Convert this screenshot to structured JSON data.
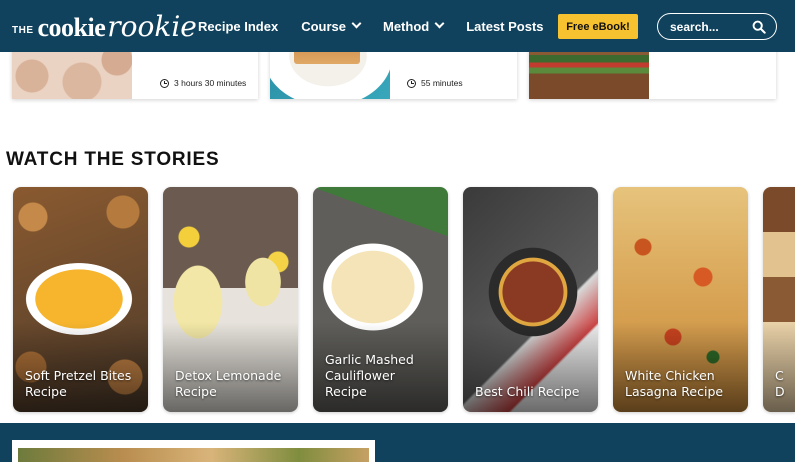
{
  "header": {
    "logo": {
      "the": "THE",
      "word1": "cookie",
      "word2": "rookie"
    },
    "nav": [
      {
        "label": "Recipe Index",
        "dropdown": false
      },
      {
        "label": "Course",
        "dropdown": true
      },
      {
        "label": "Method",
        "dropdown": true
      },
      {
        "label": "Latest Posts",
        "dropdown": false
      }
    ],
    "ebook_label": "Free eBook!",
    "search_placeholder": "search..."
  },
  "top_cards": [
    {
      "time": "3 hours 30 minutes"
    },
    {
      "time": "55 minutes"
    },
    {
      "time": ""
    }
  ],
  "section_title": "WATCH THE STORIES",
  "stories": [
    {
      "title": "Soft Pretzel Bites Recipe"
    },
    {
      "title": "Detox Lemonade Recipe"
    },
    {
      "title": "Garlic Mashed Cauliflower Recipe"
    },
    {
      "title": "Best Chili Recipe"
    },
    {
      "title": "White Chicken Lasagna Recipe"
    },
    {
      "title": "C D"
    }
  ],
  "colors": {
    "brand_navy": "#10425d",
    "ebook_yellow": "#f7c22f"
  }
}
